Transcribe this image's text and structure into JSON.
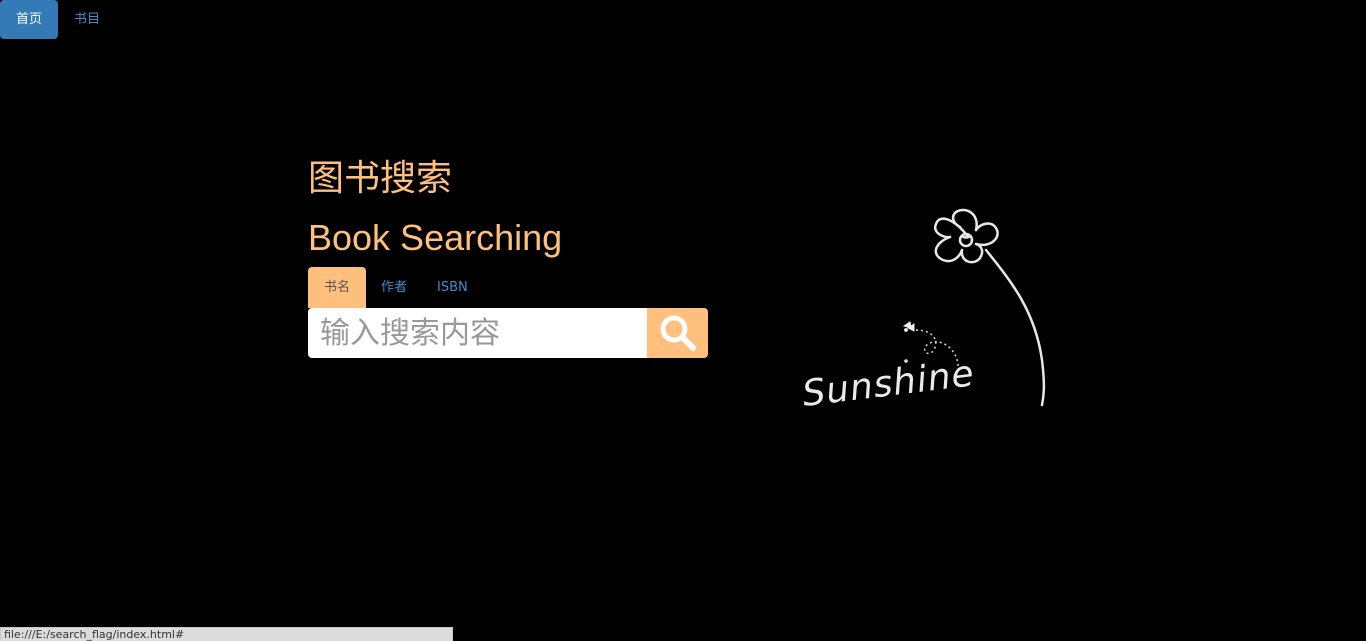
{
  "nav": {
    "items": [
      {
        "label": "首页",
        "active": true
      },
      {
        "label": "书目",
        "active": false
      }
    ]
  },
  "hero": {
    "title_cn": "图书搜索",
    "title_en": "Book Searching"
  },
  "search": {
    "tabs": [
      {
        "label": "书名",
        "active": true
      },
      {
        "label": "作者",
        "active": false
      },
      {
        "label": "ISBN",
        "active": false
      }
    ],
    "placeholder": "输入搜索内容",
    "button_icon": "search-icon"
  },
  "decoration": {
    "text": "Sunshine",
    "icons": [
      "flower-icon",
      "butterfly-icon"
    ]
  },
  "statusbar": {
    "url": "file:///E:/search_flag/index.html#"
  },
  "colors": {
    "background": "#000000",
    "accent": "#ffbf7d",
    "nav_active": "#337ab7",
    "link": "#428bca"
  }
}
